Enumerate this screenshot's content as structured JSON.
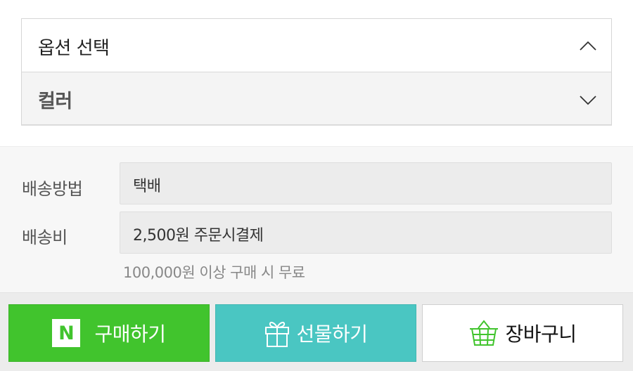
{
  "options": {
    "header_label": "옵션 선택",
    "color_label": "컬러"
  },
  "shipping": {
    "method_label": "배송방법",
    "method_value": "택배",
    "fee_label": "배송비",
    "fee_value": "2,500원  주문시결제",
    "free_note": "100,000원 이상 구매 시 무료"
  },
  "buttons": {
    "buy_label": "구매하기",
    "buy_logo": "N",
    "gift_label": "선물하기",
    "cart_label": "장바구니"
  },
  "colors": {
    "buy": "#41c42d",
    "gift": "#4ac6c2",
    "cart": "#ffffff"
  },
  "icons": {
    "header_toggle": "chevron-up-icon",
    "color_toggle": "chevron-down-icon",
    "buy": "naver-n-logo",
    "gift": "gift-icon",
    "cart": "basket-icon"
  }
}
